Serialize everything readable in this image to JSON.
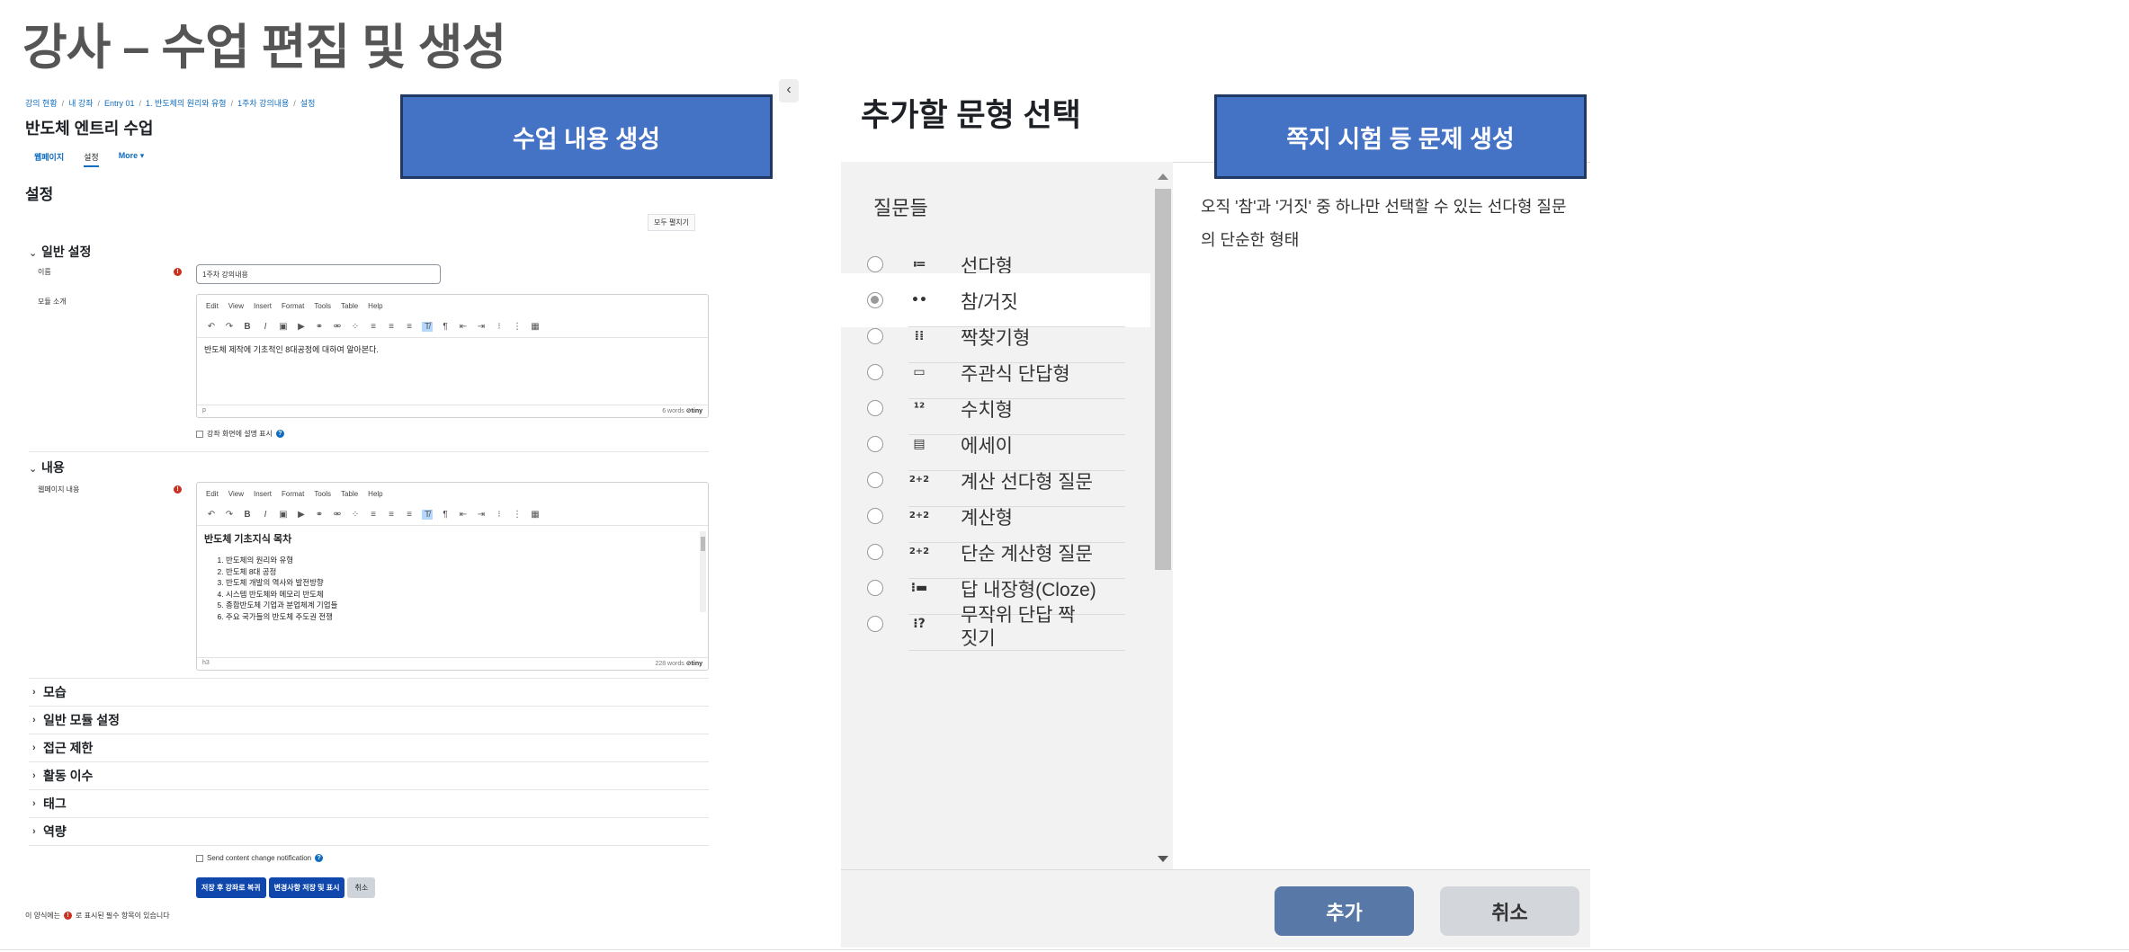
{
  "slide": {
    "title": "강사 – 수업 편집 및 생성",
    "callout_left": "수업 내용 생성",
    "callout_right": "쪽지 시험 등 문제 생성"
  },
  "editor": {
    "breadcrumb": [
      "강의 현황",
      "내 강좌",
      "Entry 01",
      "1. 반도체의 원리와 유형",
      "1주차 강의내용",
      "설정"
    ],
    "course_title": "반도체 엔트리 수업",
    "tabs": [
      "웹페이지",
      "설정",
      "More ▾"
    ],
    "settings_heading": "설정",
    "expand_all": "모두 펼치기",
    "general_section": "일반 설정",
    "name_label": "이름",
    "name_value": "1주차 강의내용",
    "desc_label": "모듈 소개",
    "tiny_menu": [
      "Edit",
      "View",
      "Insert",
      "Format",
      "Tools",
      "Table",
      "Help"
    ],
    "desc_text": "반도체 제작에 기초적인 8대공정에 대하여 알아본다.",
    "desc_status_left": "p",
    "desc_status_words": "6 words",
    "tiny_brand": "⊘tiny",
    "show_desc_label": "강좌 화면에 설명 표시",
    "content_section": "내용",
    "page_content_label": "웹페이지 내용",
    "content_heading": "반도체 기초지식 목차",
    "toc": [
      "반도체의 원리와 유형",
      "반도체 8대 공정",
      "반도체 개발의 역사와 발전방향",
      "시스템 반도체와 메모리 반도체",
      "종합반도체 기업과 분업체계 기업들",
      "주요 국가들의 반도체 주도권 전쟁"
    ],
    "content_status_left": "h3",
    "content_status_words": "228 words",
    "collapsed_sections": [
      "모습",
      "일반 모듈 설정",
      "접근 제한",
      "활동 이수",
      "태그",
      "역량"
    ],
    "notify_label": "Send content change notification",
    "buttons": {
      "save_return": "저장 후 강좌로 복귀",
      "save_display": "변경사항 저장 및 표시",
      "cancel": "취소"
    },
    "required_note_prefix": "이 양식에는",
    "required_note_suffix": "로 표시된 필수 항목이 있습니다"
  },
  "chooser": {
    "title": "추가할 문형 선택",
    "list_heading": "질문들",
    "questions": [
      {
        "label": "선다형",
        "icon": "≔",
        "icon_name": "multichoice-icon"
      },
      {
        "label": "참/거짓",
        "icon": "••",
        "icon_name": "truefalse-icon"
      },
      {
        "label": "짝찾기형",
        "icon": "⁞⁞",
        "icon_name": "matching-icon"
      },
      {
        "label": "주관식 단답형",
        "icon": "▭",
        "icon_name": "shortanswer-icon"
      },
      {
        "label": "수치형",
        "icon": "¹²",
        "icon_name": "numerical-icon"
      },
      {
        "label": "에세이",
        "icon": "▤",
        "icon_name": "essay-icon"
      },
      {
        "label": "계산 선다형 질문",
        "icon": "2+2",
        "icon_name": "calcmulti-icon"
      },
      {
        "label": "계산형",
        "icon": "2+2",
        "icon_name": "calculated-icon"
      },
      {
        "label": "단순 계산형 질문",
        "icon": "2+2",
        "icon_name": "calcsimple-icon"
      },
      {
        "label": "답 내장형(Cloze)",
        "icon": "⁝▬",
        "icon_name": "cloze-icon"
      },
      {
        "label": "무작위 단답 짝짓기",
        "icon": "⁝?",
        "icon_name": "randomsamatch-icon"
      }
    ],
    "selected_index": 1,
    "description": "오직 '참'과 '거짓' 중 하나만 선택할 수 있는 선다형 질문의 단순한 형태",
    "add_button": "추가",
    "cancel_button": "취소"
  }
}
